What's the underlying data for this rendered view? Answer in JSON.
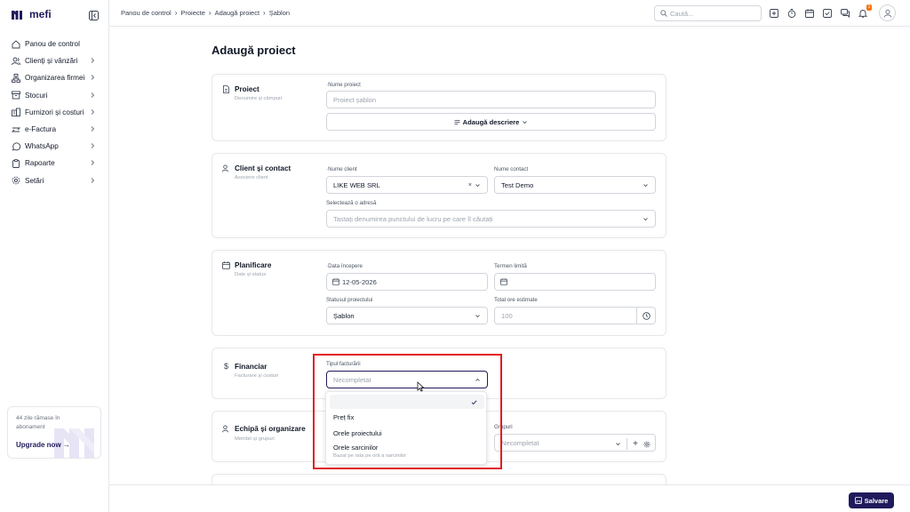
{
  "app": {
    "logo_text": "mefi"
  },
  "sidebar": {
    "items": [
      {
        "label": "Panou de control",
        "icon": "home-icon",
        "chevron": false
      },
      {
        "label": "Clienți și vânzări",
        "icon": "users-icon",
        "chevron": true
      },
      {
        "label": "Organizarea firmei",
        "icon": "org-chart-icon",
        "chevron": true
      },
      {
        "label": "Stocuri",
        "icon": "box-icon",
        "chevron": true
      },
      {
        "label": "Furnizori și costuri",
        "icon": "building-icon",
        "chevron": true
      },
      {
        "label": "e-Factura",
        "icon": "efactura-icon",
        "chevron": true
      },
      {
        "label": "WhatsApp",
        "icon": "whatsapp-icon",
        "chevron": true
      },
      {
        "label": "Rapoarte",
        "icon": "clipboard-icon",
        "chevron": true
      },
      {
        "label": "Setări",
        "icon": "gear-icon",
        "chevron": true
      }
    ],
    "promo": {
      "text": "44 zile rămase în abonament",
      "link": "Upgrade now →"
    }
  },
  "topbar": {
    "breadcrumb": [
      "Panou de control",
      "Proiecte",
      "Adaugă proiect",
      "Șablon"
    ],
    "search_placeholder": "Caută...",
    "notification_count": "1"
  },
  "page": {
    "title": "Adaugă proiect"
  },
  "sections": {
    "proiect": {
      "title": "Proiect",
      "subtitle": "Denumire și câmpuri",
      "name_label": "Nume proiect",
      "name_placeholder": "Proiect șablon",
      "desc_button": "Adaugă descriere"
    },
    "client": {
      "title": "Client și contact",
      "subtitle": "Asociere client",
      "client_label": "Nume client",
      "client_value": "LIKE WEB SRL",
      "contact_label": "Nume contact",
      "contact_value": "Test Demo",
      "address_label": "Selectează o adresă",
      "address_placeholder": "Tastați denumirea punctului de lucru pe care îl căutați"
    },
    "planificare": {
      "title": "Planificare",
      "subtitle": "Date și status",
      "start_label": "Data începere",
      "start_value": "12-05-2026",
      "deadline_label": "Termen limită",
      "status_label": "Statusul proiectului",
      "status_value": "Șablon",
      "hours_label": "Total ore estimate",
      "hours_placeholder": "100"
    },
    "financiar": {
      "title": "Financiar",
      "subtitle": "Facturare și costuri",
      "billing_label": "Tipul facturării",
      "billing_value": "Necompletat",
      "options": [
        {
          "label": "Preț fix",
          "sub": ""
        },
        {
          "label": "Orele proiectului",
          "sub": ""
        },
        {
          "label": "Orele sarcinilor",
          "sub": "Bazat pe rata pe oră a sarcinilor"
        }
      ]
    },
    "echipa": {
      "title": "Echipă și organizare",
      "subtitle": "Membri și grupuri",
      "groups_label": "Grupuri",
      "groups_placeholder": "Necompletat"
    }
  },
  "footer": {
    "save_label": "Salvare"
  },
  "colors": {
    "brand": "#1f1a5c",
    "highlight": "#e11d1d",
    "badge": "#f97316"
  }
}
